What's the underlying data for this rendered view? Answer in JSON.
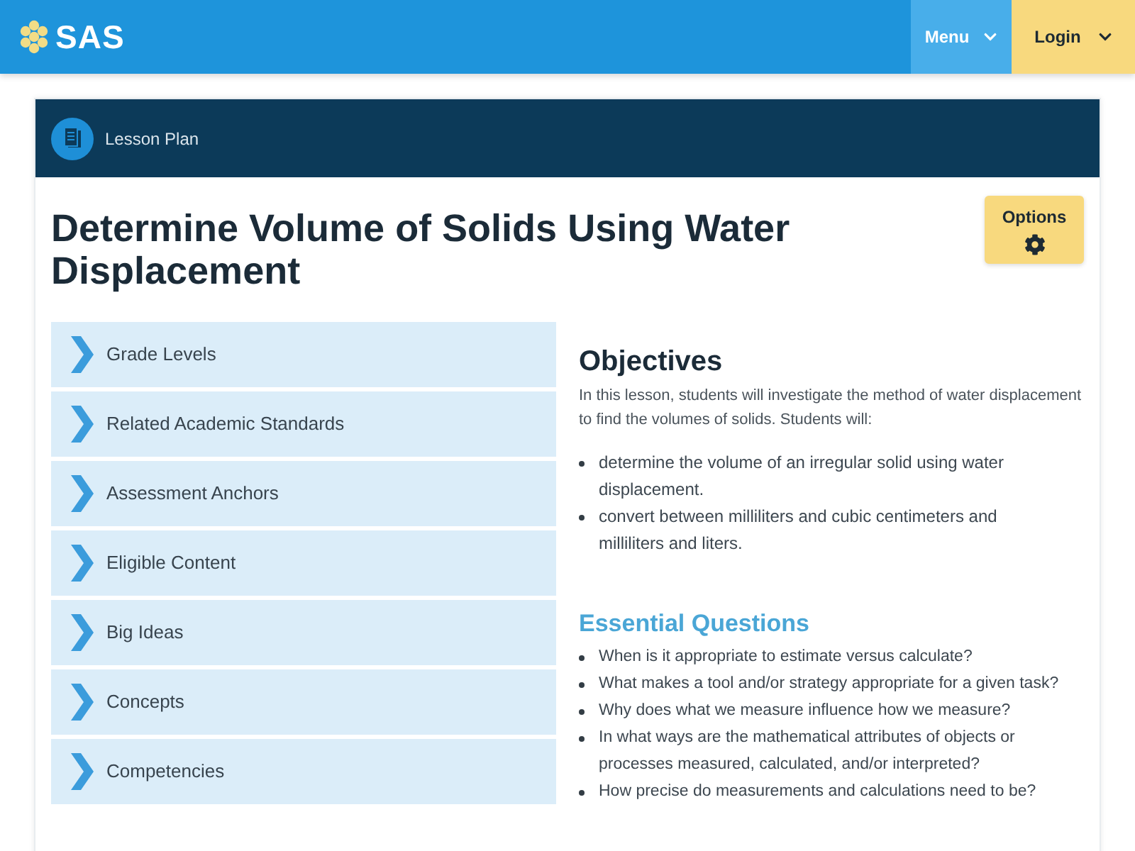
{
  "header": {
    "logo": "SAS",
    "menu": {
      "label": "Menu"
    },
    "login": {
      "label": "Login"
    }
  },
  "card": {
    "type_label": "Lesson Plan",
    "title": "Determine Volume of Solids Using Water Displacement",
    "options_button": "Options"
  },
  "accordion": [
    {
      "label": "Grade Levels",
      "expanded": false
    },
    {
      "label": "Related Academic Standards",
      "expanded": false
    },
    {
      "label": "Assessment Anchors",
      "expanded": false
    },
    {
      "label": "Eligible Content",
      "expanded": false
    },
    {
      "label": "Big Ideas",
      "expanded": false
    },
    {
      "label": "Concepts",
      "expanded": false
    },
    {
      "label": "Competencies",
      "expanded": false
    }
  ],
  "objectives": {
    "heading": "Objectives",
    "intro": "In this lesson, students will investigate the method of water displacement to find the volumes of solids. Students will:",
    "items": [
      "determine the volume of an irregular solid using water displacement.",
      "convert between milliliters and cubic centimeters and milliliters and liters."
    ]
  },
  "essential_questions": {
    "heading": "Essential Questions",
    "items": [
      "When is it appropriate to estimate versus calculate?",
      "What makes a tool and/or strategy appropriate for a given task?",
      "Why does what we measure influence how we measure?",
      "In what ways are the mathematical attributes of objects or processes measured, calculated, and/or interpreted?",
      "How precise do measurements and calculations need to be?"
    ]
  }
}
